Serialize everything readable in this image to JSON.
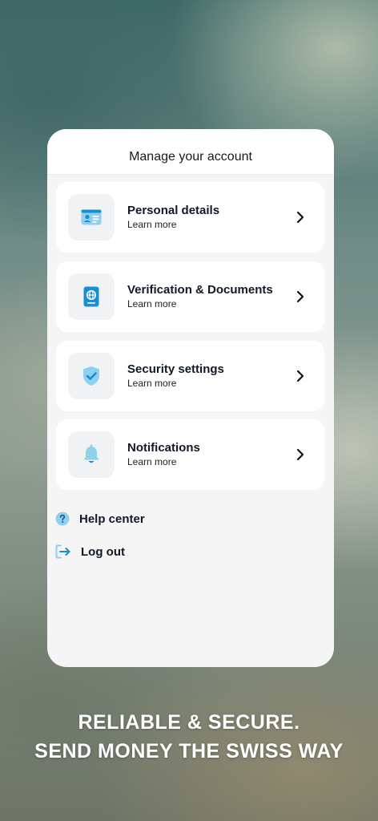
{
  "card": {
    "title": "Manage your account",
    "items": [
      {
        "title": "Personal details",
        "subtitle": "Learn more",
        "icon": "id-card-icon"
      },
      {
        "title": "Verification & Documents",
        "subtitle": "Learn more",
        "icon": "passport-icon"
      },
      {
        "title": "Security settings",
        "subtitle": "Learn more",
        "icon": "shield-check-icon"
      },
      {
        "title": "Notifications",
        "subtitle": "Learn more",
        "icon": "bell-icon"
      }
    ],
    "links": [
      {
        "label": "Help center",
        "icon": "help-icon"
      },
      {
        "label": "Log out",
        "icon": "logout-icon"
      }
    ]
  },
  "tagline": {
    "line1": "RELIABLE & SECURE.",
    "line2": "SEND MONEY THE SWISS WAY"
  },
  "colors": {
    "accent": "#1a8fd0",
    "light_accent": "#8fd0ef"
  }
}
